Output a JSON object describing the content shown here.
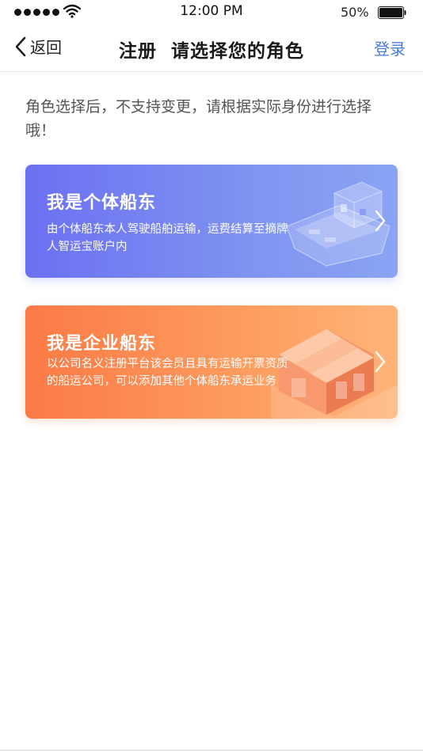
{
  "status_bar": {
    "time": "12:00 PM",
    "battery_percent": "50%",
    "signal_icon": "signal-dots-icon",
    "wifi_icon": "wifi-icon",
    "battery_icon": "battery-icon"
  },
  "nav": {
    "back_label": "返回",
    "title": "注册  请选择您的角色",
    "action_label": "登录",
    "action_color": "#4a7bdc"
  },
  "notice": "角色选择后，不支持变更，请根据实际身份进行选择哦！",
  "roles": [
    {
      "title": "我是个体船东",
      "description": "由个体船东本人驾驶船舶运输，运费结算至摘牌人智运宝账户内",
      "illustration_icon": "ship-icon",
      "gradient": [
        "#6b70f2",
        "#8aa4f3"
      ]
    },
    {
      "title": "我是企业船东",
      "description": "以公司名义注册平台该会员且具有运输开票资质的船运公司，可以添加其他个体船东承运业务",
      "illustration_icon": "warehouse-icon",
      "gradient": [
        "#fb7a45",
        "#ffb47a"
      ]
    }
  ]
}
